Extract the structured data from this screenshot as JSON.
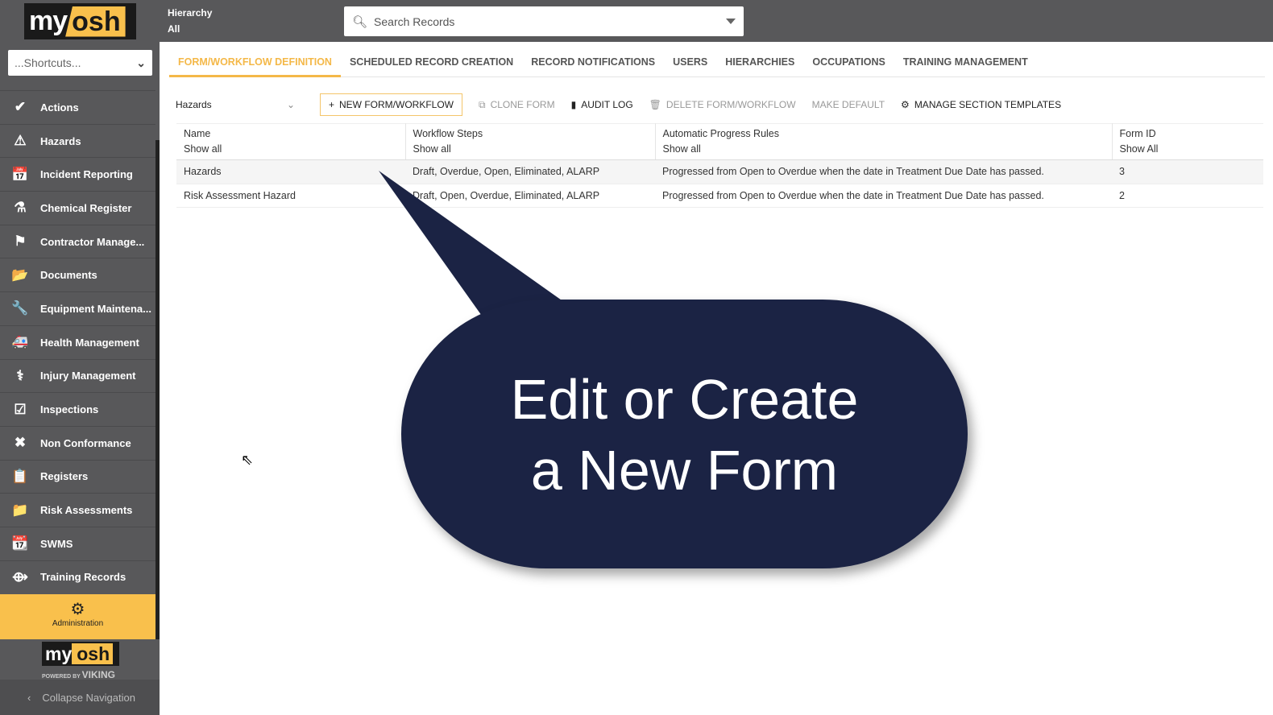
{
  "header": {
    "logo_my": "my",
    "logo_osh": "osh",
    "hierarchy_label": "Hierarchy",
    "hierarchy_value": "All",
    "search_placeholder": "Search Records"
  },
  "sidebar": {
    "shortcuts": "...Shortcuts...",
    "items": [
      {
        "label": "Actions",
        "icon": "✔"
      },
      {
        "label": "Hazards",
        "icon": "⚠"
      },
      {
        "label": "Incident Reporting",
        "icon": "📅"
      },
      {
        "label": "Chemical Register",
        "icon": "⚗"
      },
      {
        "label": "Contractor Manage...",
        "icon": "⚑"
      },
      {
        "label": "Documents",
        "icon": "📂"
      },
      {
        "label": "Equipment Maintena...",
        "icon": "🔧"
      },
      {
        "label": "Health Management",
        "icon": "🚑"
      },
      {
        "label": "Injury Management",
        "icon": "⚕"
      },
      {
        "label": "Inspections",
        "icon": "☑"
      },
      {
        "label": "Non Conformance",
        "icon": "✖"
      },
      {
        "label": "Registers",
        "icon": "📋"
      },
      {
        "label": "Risk Assessments",
        "icon": "📁"
      },
      {
        "label": "SWMS",
        "icon": "📆"
      },
      {
        "label": "Training Records",
        "icon": "⟴"
      }
    ],
    "admin": "Administration",
    "powered": "POWERED BY",
    "viking": "VIKING",
    "collapse": "Collapse Navigation"
  },
  "tabs": [
    "FORM/WORKFLOW DEFINITION",
    "SCHEDULED RECORD CREATION",
    "RECORD NOTIFICATIONS",
    "USERS",
    "HIERARCHIES",
    "OCCUPATIONS",
    "TRAINING MANAGEMENT"
  ],
  "toolbar": {
    "module": "Hazards",
    "new": "NEW FORM/WORKFLOW",
    "clone": "CLONE FORM",
    "audit": "AUDIT LOG",
    "delete": "DELETE FORM/WORKFLOW",
    "default": "MAKE DEFAULT",
    "manage": "MANAGE SECTION TEMPLATES"
  },
  "table": {
    "columns": [
      {
        "title": "Name",
        "filter": "Show all"
      },
      {
        "title": "Workflow Steps",
        "filter": "Show all"
      },
      {
        "title": "Automatic Progress Rules",
        "filter": "Show all"
      },
      {
        "title": "Form ID",
        "filter": "Show All"
      }
    ],
    "rows": [
      [
        "Hazards",
        "Draft, Overdue, Open, Eliminated, ALARP",
        "Progressed from Open to Overdue when the date in Treatment Due Date has passed.",
        "3"
      ],
      [
        "Risk Assessment Hazard",
        "Draft, Open, Overdue, Eliminated, ALARP",
        "Progressed from Open to Overdue when the date in Treatment Due Date has passed.",
        "2"
      ]
    ]
  },
  "callout": {
    "line1": "Edit or Create",
    "line2": "a New Form"
  },
  "colors": {
    "accent": "#f4b848",
    "callout": "#1b2344",
    "chrome": "#58585a"
  }
}
